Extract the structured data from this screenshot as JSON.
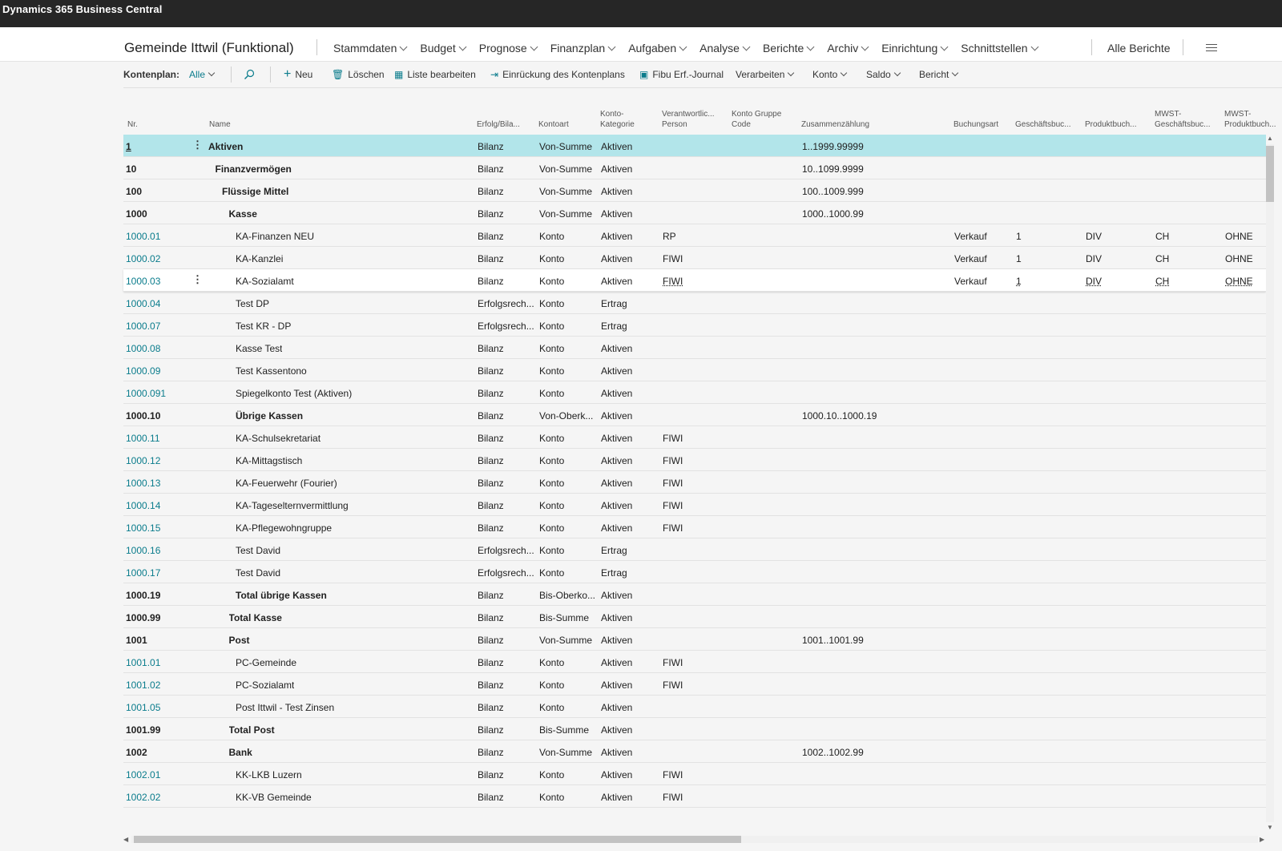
{
  "topbar": {
    "brand": "Dynamics 365 Business Central"
  },
  "nav": {
    "company": "Gemeinde Ittwil (Funktional)",
    "menu": [
      "Stammdaten",
      "Budget",
      "Prognose",
      "Finanzplan",
      "Aufgaben",
      "Analyse",
      "Berichte",
      "Archiv",
      "Einrichtung",
      "Schnittstellen"
    ],
    "all_reports": "Alle Berichte"
  },
  "actionbar": {
    "label": "Kontenplan:",
    "filter": "Alle",
    "new": "Neu",
    "delete": "Löschen",
    "edit_list": "Liste bearbeiten",
    "indent": "Einrückung des Kontenplans",
    "journal": "Fibu Erf.-Journal",
    "process": "Verarbeiten",
    "account": "Konto",
    "balance": "Saldo",
    "report": "Bericht"
  },
  "columns": {
    "nr": "Nr.",
    "name": "Name",
    "income": "Erfolg/Bila...",
    "type": "Kontoart",
    "category1": "Konto-",
    "category2": "Kategorie",
    "resp1": "Verantwortlic...",
    "resp2": "Person",
    "group1": "Konto Gruppe",
    "group2": "Code",
    "totaling": "Zusammenzählung",
    "posting": "Buchungsart",
    "gen_bus": "Geschäftsbuc...",
    "gen_prod": "Produktbuch...",
    "vat_bus1": "MWST-",
    "vat_bus2": "Geschäftsbuc...",
    "vat_prod1": "MWST-",
    "vat_prod2": "Produktbuch..."
  },
  "rows": [
    {
      "nr": "1",
      "name": "Aktiven",
      "indent": 0,
      "bold": true,
      "income": "Bilanz",
      "type": "Von-Summe",
      "category": "Aktiven",
      "resp": "",
      "totaling": "1..1999.99999",
      "posting": "",
      "gen_bus": "",
      "gen_prod": "",
      "vat_bus": "",
      "vat_prod": ""
    },
    {
      "nr": "10",
      "name": "Finanzvermögen",
      "indent": 1,
      "bold": true,
      "income": "Bilanz",
      "type": "Von-Summe",
      "category": "Aktiven",
      "resp": "",
      "totaling": "10..1099.9999",
      "posting": "",
      "gen_bus": "",
      "gen_prod": "",
      "vat_bus": "",
      "vat_prod": ""
    },
    {
      "nr": "100",
      "name": "Flüssige Mittel",
      "indent": 2,
      "bold": true,
      "income": "Bilanz",
      "type": "Von-Summe",
      "category": "Aktiven",
      "resp": "",
      "totaling": "100..1009.999",
      "posting": "",
      "gen_bus": "",
      "gen_prod": "",
      "vat_bus": "",
      "vat_prod": ""
    },
    {
      "nr": "1000",
      "name": "Kasse",
      "indent": 3,
      "bold": true,
      "income": "Bilanz",
      "type": "Von-Summe",
      "category": "Aktiven",
      "resp": "",
      "totaling": "1000..1000.99",
      "posting": "",
      "gen_bus": "",
      "gen_prod": "",
      "vat_bus": "",
      "vat_prod": ""
    },
    {
      "nr": "1000.01",
      "name": "KA-Finanzen NEU",
      "indent": 4,
      "bold": false,
      "income": "Bilanz",
      "type": "Konto",
      "category": "Aktiven",
      "resp": "RP",
      "totaling": "",
      "posting": "Verkauf",
      "gen_bus": "1",
      "gen_prod": "DIV",
      "vat_bus": "CH",
      "vat_prod": "OHNE"
    },
    {
      "nr": "1000.02",
      "name": "KA-Kanzlei",
      "indent": 4,
      "bold": false,
      "income": "Bilanz",
      "type": "Konto",
      "category": "Aktiven",
      "resp": "FIWI",
      "totaling": "",
      "posting": "Verkauf",
      "gen_bus": "1",
      "gen_prod": "DIV",
      "vat_bus": "CH",
      "vat_prod": "OHNE"
    },
    {
      "nr": "1000.03",
      "name": "KA-Sozialamt",
      "indent": 4,
      "bold": false,
      "income": "Bilanz",
      "type": "Konto",
      "category": "Aktiven",
      "resp": "FIWI",
      "totaling": "",
      "posting": "Verkauf",
      "gen_bus": "1",
      "gen_prod": "DIV",
      "vat_bus": "CH",
      "vat_prod": "OHNE"
    },
    {
      "nr": "1000.04",
      "name": "Test DP",
      "indent": 4,
      "bold": false,
      "income": "Erfolgsrech...",
      "type": "Konto",
      "category": "Ertrag",
      "resp": "",
      "totaling": "",
      "posting": "",
      "gen_bus": "",
      "gen_prod": "",
      "vat_bus": "",
      "vat_prod": ""
    },
    {
      "nr": "1000.07",
      "name": "Test KR - DP",
      "indent": 4,
      "bold": false,
      "income": "Erfolgsrech...",
      "type": "Konto",
      "category": "Ertrag",
      "resp": "",
      "totaling": "",
      "posting": "",
      "gen_bus": "",
      "gen_prod": "",
      "vat_bus": "",
      "vat_prod": ""
    },
    {
      "nr": "1000.08",
      "name": "Kasse Test",
      "indent": 4,
      "bold": false,
      "income": "Bilanz",
      "type": "Konto",
      "category": "Aktiven",
      "resp": "",
      "totaling": "",
      "posting": "",
      "gen_bus": "",
      "gen_prod": "",
      "vat_bus": "",
      "vat_prod": ""
    },
    {
      "nr": "1000.09",
      "name": "Test Kassentono",
      "indent": 4,
      "bold": false,
      "income": "Bilanz",
      "type": "Konto",
      "category": "Aktiven",
      "resp": "",
      "totaling": "",
      "posting": "",
      "gen_bus": "",
      "gen_prod": "",
      "vat_bus": "",
      "vat_prod": ""
    },
    {
      "nr": "1000.091",
      "name": "Spiegelkonto Test (Aktiven)",
      "indent": 4,
      "bold": false,
      "income": "Bilanz",
      "type": "Konto",
      "category": "Aktiven",
      "resp": "",
      "totaling": "",
      "posting": "",
      "gen_bus": "",
      "gen_prod": "",
      "vat_bus": "",
      "vat_prod": ""
    },
    {
      "nr": "1000.10",
      "name": "Übrige Kassen",
      "indent": 4,
      "bold": true,
      "income": "Bilanz",
      "type": "Von-Oberk...",
      "category": "Aktiven",
      "resp": "",
      "totaling": "1000.10..1000.19",
      "posting": "",
      "gen_bus": "",
      "gen_prod": "",
      "vat_bus": "",
      "vat_prod": ""
    },
    {
      "nr": "1000.11",
      "name": "KA-Schulsekretariat",
      "indent": 4,
      "bold": false,
      "income": "Bilanz",
      "type": "Konto",
      "category": "Aktiven",
      "resp": "FIWI",
      "totaling": "",
      "posting": "",
      "gen_bus": "",
      "gen_prod": "",
      "vat_bus": "",
      "vat_prod": ""
    },
    {
      "nr": "1000.12",
      "name": "KA-Mittagstisch",
      "indent": 4,
      "bold": false,
      "income": "Bilanz",
      "type": "Konto",
      "category": "Aktiven",
      "resp": "FIWI",
      "totaling": "",
      "posting": "",
      "gen_bus": "",
      "gen_prod": "",
      "vat_bus": "",
      "vat_prod": ""
    },
    {
      "nr": "1000.13",
      "name": "KA-Feuerwehr (Fourier)",
      "indent": 4,
      "bold": false,
      "income": "Bilanz",
      "type": "Konto",
      "category": "Aktiven",
      "resp": "FIWI",
      "totaling": "",
      "posting": "",
      "gen_bus": "",
      "gen_prod": "",
      "vat_bus": "",
      "vat_prod": ""
    },
    {
      "nr": "1000.14",
      "name": "KA-Tageselternvermittlung",
      "indent": 4,
      "bold": false,
      "income": "Bilanz",
      "type": "Konto",
      "category": "Aktiven",
      "resp": "FIWI",
      "totaling": "",
      "posting": "",
      "gen_bus": "",
      "gen_prod": "",
      "vat_bus": "",
      "vat_prod": ""
    },
    {
      "nr": "1000.15",
      "name": "KA-Pflegewohngruppe",
      "indent": 4,
      "bold": false,
      "income": "Bilanz",
      "type": "Konto",
      "category": "Aktiven",
      "resp": "FIWI",
      "totaling": "",
      "posting": "",
      "gen_bus": "",
      "gen_prod": "",
      "vat_bus": "",
      "vat_prod": ""
    },
    {
      "nr": "1000.16",
      "name": "Test David",
      "indent": 4,
      "bold": false,
      "income": "Erfolgsrech...",
      "type": "Konto",
      "category": "Ertrag",
      "resp": "",
      "totaling": "",
      "posting": "",
      "gen_bus": "",
      "gen_prod": "",
      "vat_bus": "",
      "vat_prod": ""
    },
    {
      "nr": "1000.17",
      "name": "Test David",
      "indent": 4,
      "bold": false,
      "income": "Erfolgsrech...",
      "type": "Konto",
      "category": "Ertrag",
      "resp": "",
      "totaling": "",
      "posting": "",
      "gen_bus": "",
      "gen_prod": "",
      "vat_bus": "",
      "vat_prod": ""
    },
    {
      "nr": "1000.19",
      "name": "Total übrige Kassen",
      "indent": 4,
      "bold": true,
      "income": "Bilanz",
      "type": "Bis-Oberko...",
      "category": "Aktiven",
      "resp": "",
      "totaling": "",
      "posting": "",
      "gen_bus": "",
      "gen_prod": "",
      "vat_bus": "",
      "vat_prod": ""
    },
    {
      "nr": "1000.99",
      "name": "Total Kasse",
      "indent": 3,
      "bold": true,
      "income": "Bilanz",
      "type": "Bis-Summe",
      "category": "Aktiven",
      "resp": "",
      "totaling": "",
      "posting": "",
      "gen_bus": "",
      "gen_prod": "",
      "vat_bus": "",
      "vat_prod": ""
    },
    {
      "nr": "1001",
      "name": "Post",
      "indent": 3,
      "bold": true,
      "income": "Bilanz",
      "type": "Von-Summe",
      "category": "Aktiven",
      "resp": "",
      "totaling": "1001..1001.99",
      "posting": "",
      "gen_bus": "",
      "gen_prod": "",
      "vat_bus": "",
      "vat_prod": ""
    },
    {
      "nr": "1001.01",
      "name": "PC-Gemeinde",
      "indent": 4,
      "bold": false,
      "income": "Bilanz",
      "type": "Konto",
      "category": "Aktiven",
      "resp": "FIWI",
      "totaling": "",
      "posting": "",
      "gen_bus": "",
      "gen_prod": "",
      "vat_bus": "",
      "vat_prod": ""
    },
    {
      "nr": "1001.02",
      "name": "PC-Sozialamt",
      "indent": 4,
      "bold": false,
      "income": "Bilanz",
      "type": "Konto",
      "category": "Aktiven",
      "resp": "FIWI",
      "totaling": "",
      "posting": "",
      "gen_bus": "",
      "gen_prod": "",
      "vat_bus": "",
      "vat_prod": ""
    },
    {
      "nr": "1001.05",
      "name": "Post Ittwil - Test Zinsen",
      "indent": 4,
      "bold": false,
      "income": "Bilanz",
      "type": "Konto",
      "category": "Aktiven",
      "resp": "",
      "totaling": "",
      "posting": "",
      "gen_bus": "",
      "gen_prod": "",
      "vat_bus": "",
      "vat_prod": ""
    },
    {
      "nr": "1001.99",
      "name": "Total Post",
      "indent": 3,
      "bold": true,
      "income": "Bilanz",
      "type": "Bis-Summe",
      "category": "Aktiven",
      "resp": "",
      "totaling": "",
      "posting": "",
      "gen_bus": "",
      "gen_prod": "",
      "vat_bus": "",
      "vat_prod": ""
    },
    {
      "nr": "1002",
      "name": "Bank",
      "indent": 3,
      "bold": true,
      "income": "Bilanz",
      "type": "Von-Summe",
      "category": "Aktiven",
      "resp": "",
      "totaling": "1002..1002.99",
      "posting": "",
      "gen_bus": "",
      "gen_prod": "",
      "vat_bus": "",
      "vat_prod": ""
    },
    {
      "nr": "1002.01",
      "name": "KK-LKB Luzern",
      "indent": 4,
      "bold": false,
      "income": "Bilanz",
      "type": "Konto",
      "category": "Aktiven",
      "resp": "FIWI",
      "totaling": "",
      "posting": "",
      "gen_bus": "",
      "gen_prod": "",
      "vat_bus": "",
      "vat_prod": ""
    },
    {
      "nr": "1002.02",
      "name": "KK-VB Gemeinde",
      "indent": 4,
      "bold": false,
      "income": "Bilanz",
      "type": "Konto",
      "category": "Aktiven",
      "resp": "FIWI",
      "totaling": "",
      "posting": "",
      "gen_bus": "",
      "gen_prod": "",
      "vat_bus": "",
      "vat_prod": ""
    }
  ],
  "selected_row": "1",
  "hovered_row": "1000.03",
  "colors": {
    "accent": "#0a7c8c",
    "selected": "#b2e5ea",
    "topbar": "#262626"
  }
}
